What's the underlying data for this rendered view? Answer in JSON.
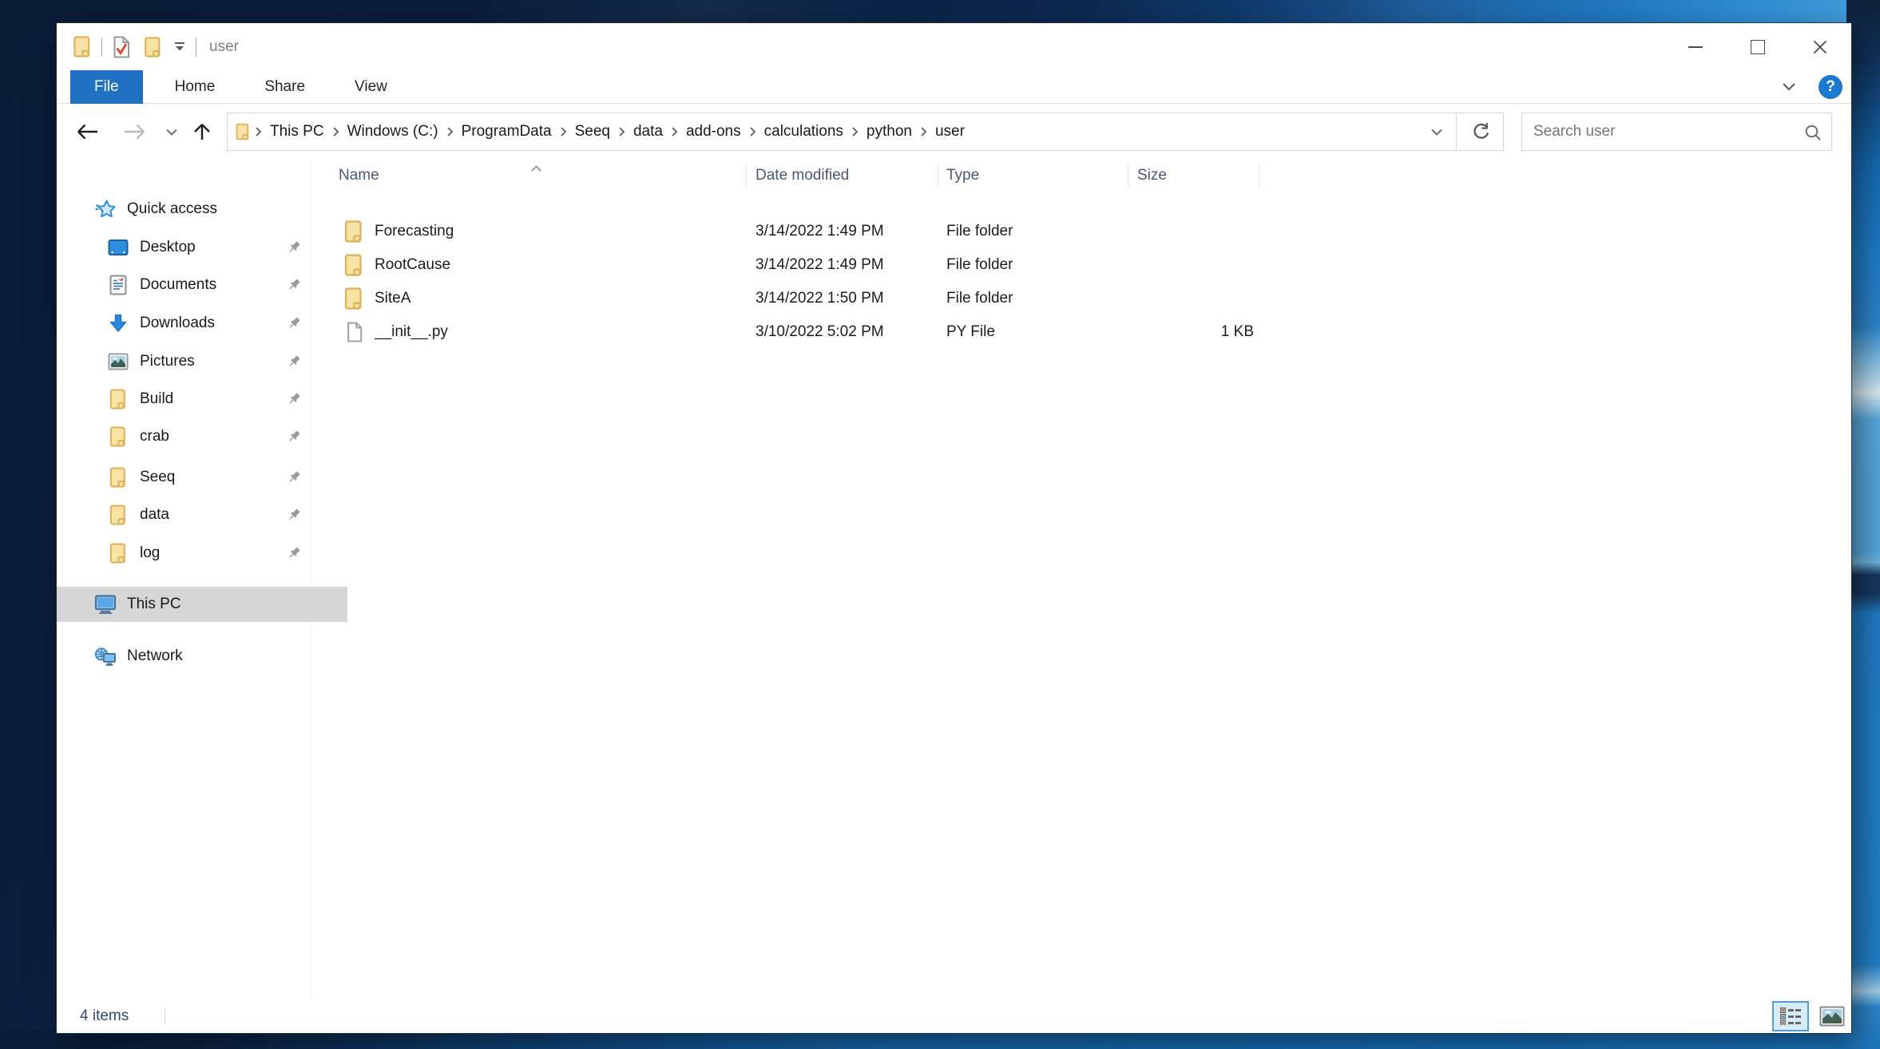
{
  "colors": {
    "accent_blue": "#2071c2",
    "folder_yellow": "#f7e3a6",
    "selection_gray": "#d6d6d6",
    "desktop_navy": "#0b2040",
    "desktop_blue": "#2f8ed4"
  },
  "icons": {
    "help_glyph": "?",
    "list": [
      "explorer-folder",
      "checkmark-document",
      "new-folder",
      "qat-dropdown",
      "back-arrow",
      "forward-arrow",
      "recent-locations-chevron",
      "up-arrow",
      "address-folder",
      "breadcrumb-chevron",
      "address-dropdown-chevron",
      "refresh",
      "search-magnifier",
      "quick-access-star",
      "desktop-monitor",
      "document",
      "download-arrow",
      "picture",
      "folder",
      "computer",
      "network",
      "pushpin",
      "python-file",
      "sort-ascending-caret",
      "details-view",
      "thumbnail-view",
      "ribbon-expand-chevron",
      "help-question"
    ]
  },
  "titlebar": {
    "title": "user"
  },
  "ribbon": {
    "tabs": [
      {
        "label": "File",
        "active": true
      },
      {
        "label": "Home",
        "active": false
      },
      {
        "label": "Share",
        "active": false
      },
      {
        "label": "View",
        "active": false
      }
    ]
  },
  "navbar": {
    "breadcrumb": [
      "This PC",
      "Windows (C:)",
      "ProgramData",
      "Seeq",
      "data",
      "add-ons",
      "calculations",
      "python",
      "user"
    ],
    "search_placeholder": "Search user"
  },
  "sidebar": {
    "items": [
      {
        "label": "Quick access",
        "icon": "quick-access-star",
        "level": 0,
        "pinned": false,
        "selected": false
      },
      {
        "label": "Desktop",
        "icon": "desktop-monitor",
        "level": 1,
        "pinned": true,
        "selected": false
      },
      {
        "label": "Documents",
        "icon": "document",
        "level": 1,
        "pinned": true,
        "selected": false
      },
      {
        "label": "Downloads",
        "icon": "download-arrow",
        "level": 1,
        "pinned": true,
        "selected": false
      },
      {
        "label": "Pictures",
        "icon": "picture",
        "level": 1,
        "pinned": true,
        "selected": false
      },
      {
        "label": "Build",
        "icon": "folder",
        "level": 1,
        "pinned": true,
        "selected": false
      },
      {
        "label": "crab",
        "icon": "folder",
        "level": 1,
        "pinned": true,
        "selected": false
      },
      {
        "label": "Seeq",
        "icon": "folder",
        "level": 1,
        "pinned": true,
        "selected": false
      },
      {
        "label": "data",
        "icon": "folder",
        "level": 1,
        "pinned": true,
        "selected": false
      },
      {
        "label": "log",
        "icon": "folder",
        "level": 1,
        "pinned": true,
        "selected": false
      },
      {
        "label": "This PC",
        "icon": "computer",
        "level": 0,
        "pinned": false,
        "selected": true
      },
      {
        "label": "Network",
        "icon": "network",
        "level": 0,
        "pinned": false,
        "selected": false
      }
    ]
  },
  "files": {
    "columns": [
      "Name",
      "Date modified",
      "Type",
      "Size"
    ],
    "sort": {
      "column": "Name",
      "direction": "ascending"
    },
    "rows": [
      {
        "name": "Forecasting",
        "date_modified": "3/14/2022 1:49 PM",
        "type": "File folder",
        "size": "",
        "icon": "folder"
      },
      {
        "name": "RootCause",
        "date_modified": "3/14/2022 1:49 PM",
        "type": "File folder",
        "size": "",
        "icon": "folder"
      },
      {
        "name": "SiteA",
        "date_modified": "3/14/2022 1:50 PM",
        "type": "File folder",
        "size": "",
        "icon": "folder"
      },
      {
        "name": "__init__.py",
        "date_modified": "3/10/2022 5:02 PM",
        "type": "PY File",
        "size": "1 KB",
        "icon": "python-file"
      }
    ]
  },
  "statusbar": {
    "item_count": "4 items"
  }
}
